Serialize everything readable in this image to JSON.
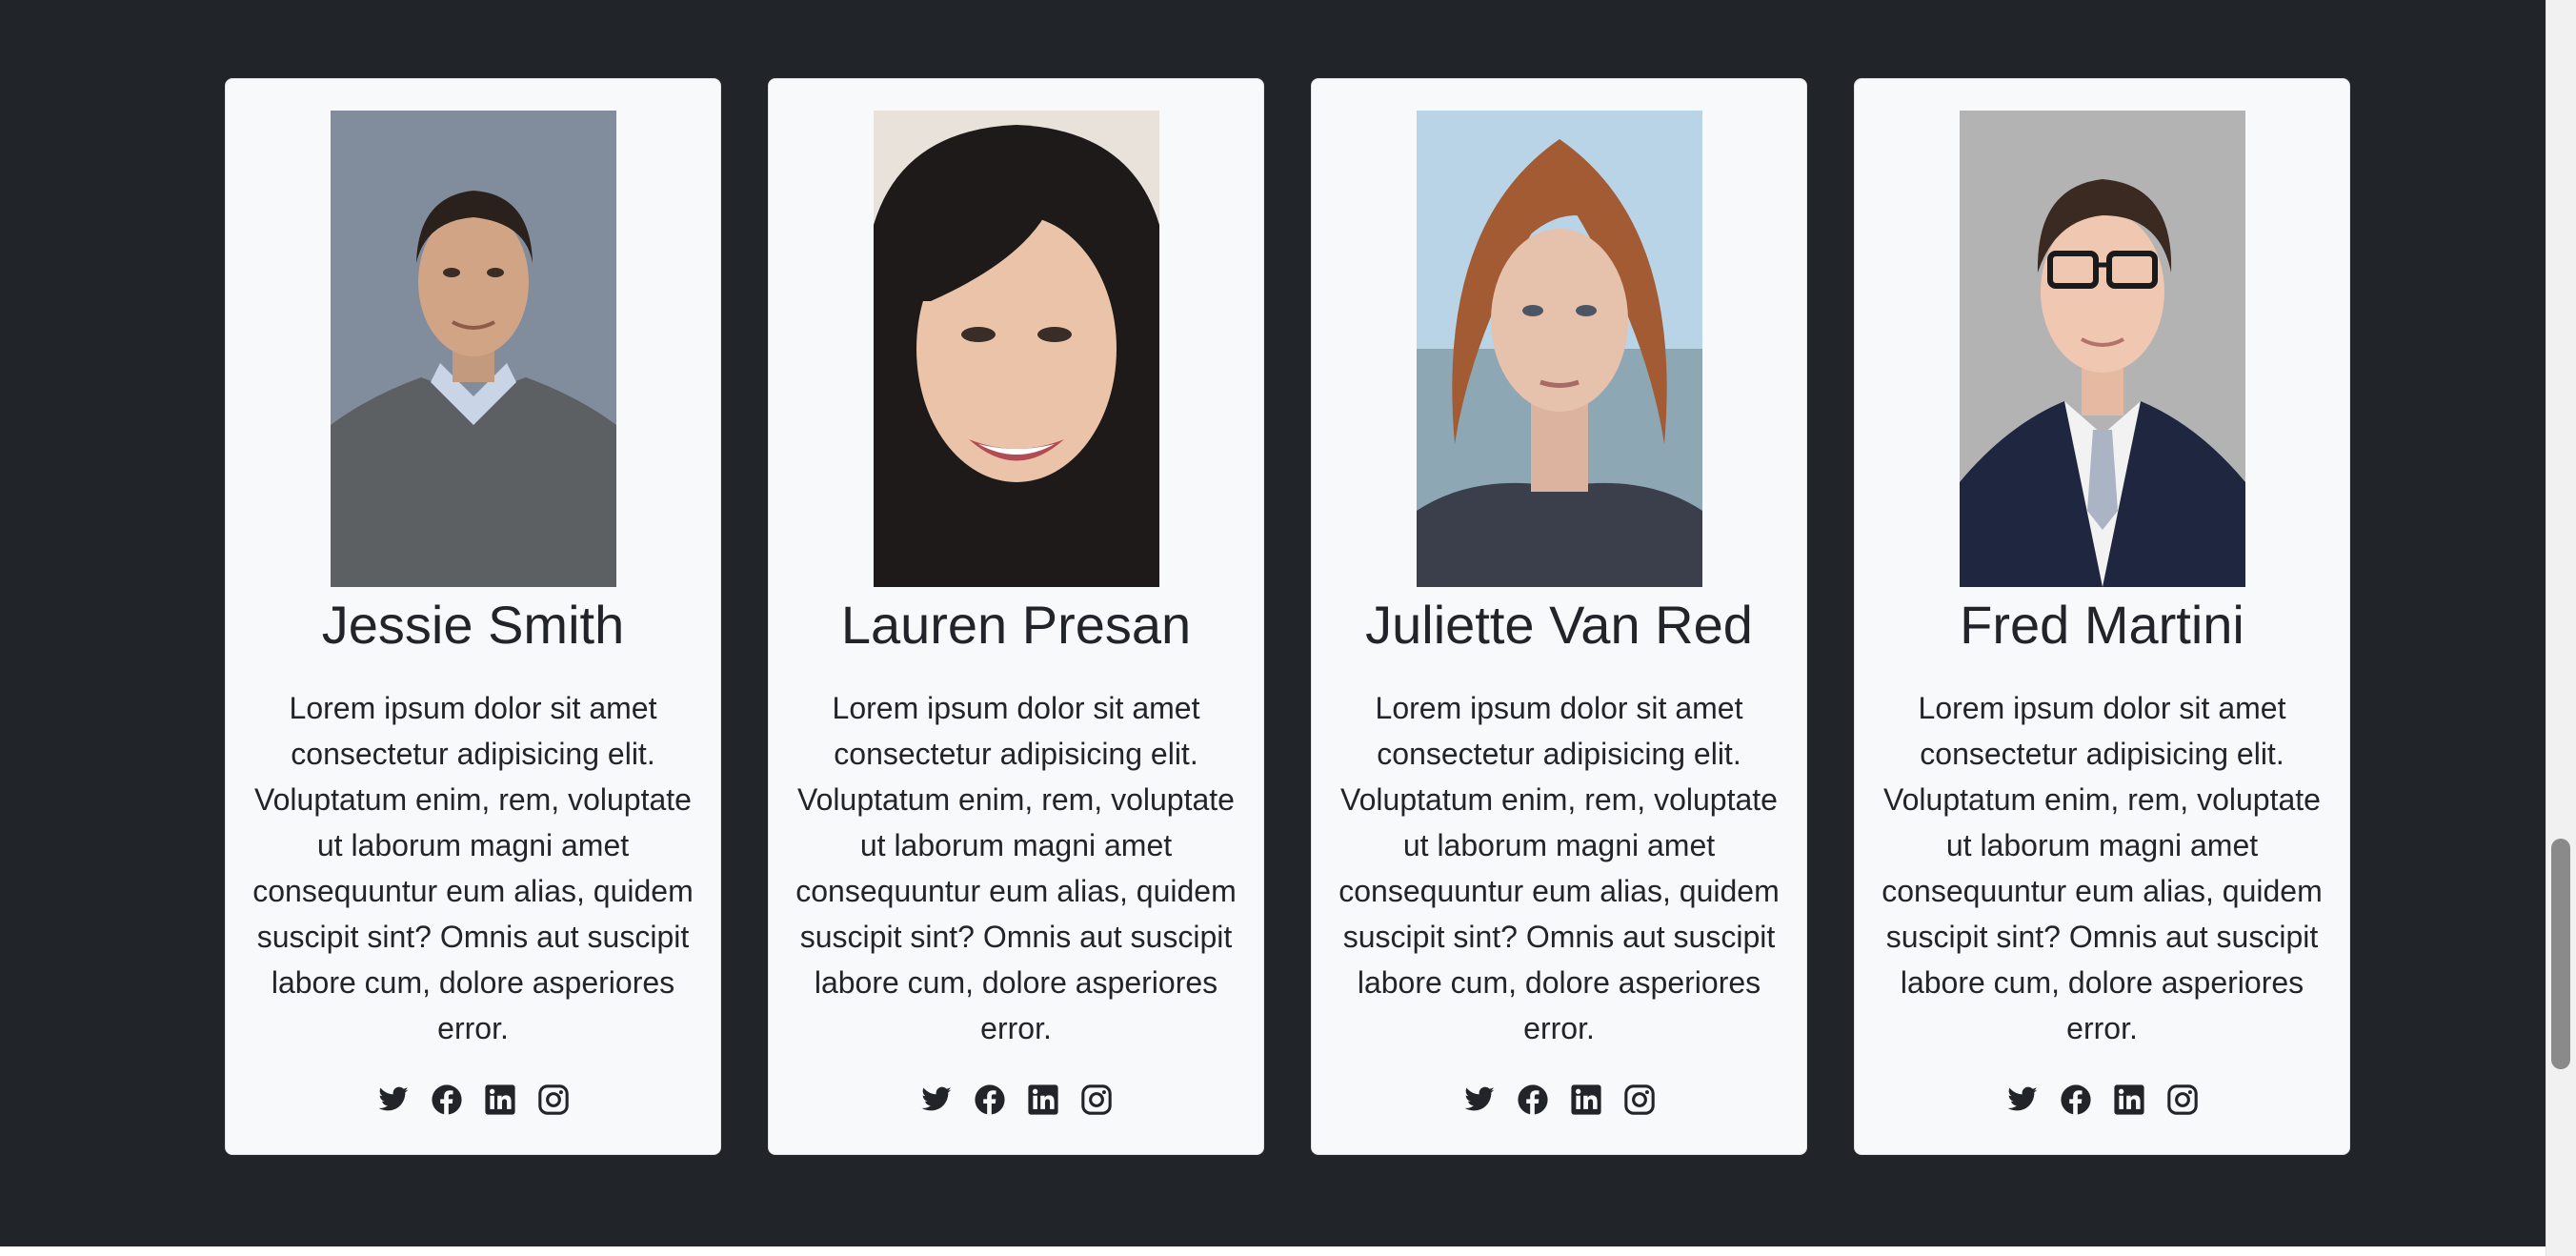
{
  "team": [
    {
      "name": "Jessie Smith",
      "bio": "Lorem ipsum dolor sit amet consectetur adipisicing elit. Voluptatum enim, rem, voluptate ut laborum magni amet consequuntur eum alias, quidem suscipit sint? Omnis aut suscipit labore cum, dolore asperiores error.",
      "photo": "portrait-man-gray-sweater",
      "socials": [
        "twitter-icon",
        "facebook-icon",
        "linkedin-icon",
        "instagram-icon"
      ]
    },
    {
      "name": "Lauren Presan",
      "bio": "Lorem ipsum dolor sit amet consectetur adipisicing elit. Voluptatum enim, rem, voluptate ut laborum magni amet consequuntur eum alias, quidem suscipit sint? Omnis aut suscipit labore cum, dolore asperiores error.",
      "photo": "portrait-woman-smiling-dark-hair",
      "socials": [
        "twitter-icon",
        "facebook-icon",
        "linkedin-icon",
        "instagram-icon"
      ]
    },
    {
      "name": "Juliette Van Red",
      "bio": "Lorem ipsum dolor sit amet consectetur adipisicing elit. Voluptatum enim, rem, voluptate ut laborum magni amet consequuntur eum alias, quidem suscipit sint? Omnis aut suscipit labore cum, dolore asperiores error.",
      "photo": "portrait-woman-red-bob",
      "socials": [
        "twitter-icon",
        "facebook-icon",
        "linkedin-icon",
        "instagram-icon"
      ]
    },
    {
      "name": "Fred Martini",
      "bio": "Lorem ipsum dolor sit amet consectetur adipisicing elit. Voluptatum enim, rem, voluptate ut laborum magni amet consequuntur eum alias, quidem suscipit sint? Omnis aut suscipit labore cum, dolore asperiores error.",
      "photo": "portrait-man-glasses-suit",
      "socials": [
        "twitter-icon",
        "facebook-icon",
        "linkedin-icon",
        "instagram-icon"
      ]
    }
  ],
  "colors": {
    "page_background": "#212529",
    "card_background": "#f8f9fa",
    "text": "#212529"
  }
}
